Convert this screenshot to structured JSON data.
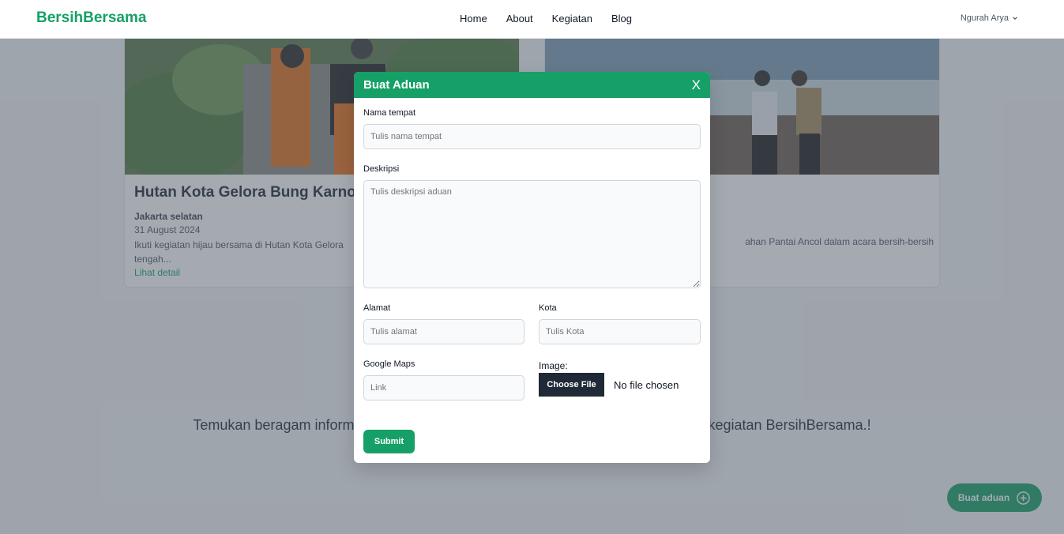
{
  "navbar": {
    "brand": "BersihBersama",
    "links": [
      "Home",
      "About",
      "Kegiatan",
      "Blog"
    ],
    "user_name": "Ngurah Arya",
    "user_icon": "chevron-down-icon"
  },
  "cards": [
    {
      "title": "Hutan Kota Gelora Bung Karno",
      "location": "Jakarta selatan",
      "date": "31 August 2024",
      "description_line1": "Ikuti kegiatan hijau bersama di Hutan Kota Gelora",
      "description_line2": "tengah...",
      "link_label": "Lihat detail"
    },
    {
      "description_fragment": "ahan Pantai Ancol dalam acara bersih-bersih"
    }
  ],
  "tagline": {
    "left": "Temukan beragam inform",
    "right": "kegiatan BersihBersama.!"
  },
  "fab": {
    "label": "Buat aduan",
    "icon": "plus-circle-icon"
  },
  "modal": {
    "title": "Buat Aduan",
    "close_label": "X",
    "fields": {
      "nama_tempat": {
        "label": "Nama tempat",
        "placeholder": "Tulis nama tempat"
      },
      "deskripsi": {
        "label": "Deskripsi",
        "placeholder": "Tulis deskripsi aduan"
      },
      "alamat": {
        "label": "Alamat",
        "placeholder": "Tulis alamat"
      },
      "kota": {
        "label": "Kota",
        "placeholder": "Tulis Kota"
      },
      "google_maps": {
        "label": "Google Maps",
        "placeholder": "Link"
      },
      "image": {
        "label": "Image:",
        "button_label": "Choose File",
        "status": "No file chosen"
      }
    },
    "submit_label": "Submit"
  },
  "colors": {
    "brand": "#16a067",
    "overlay": "rgba(75,85,99,0.5)",
    "file_button": "#1f2937"
  }
}
